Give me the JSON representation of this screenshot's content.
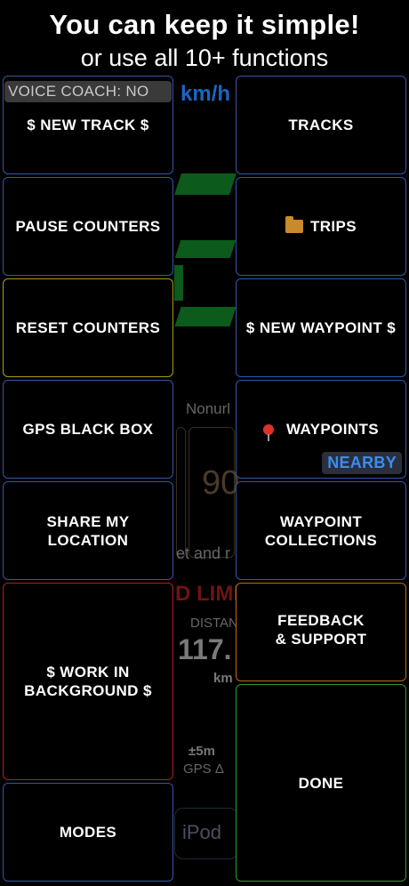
{
  "header": {
    "title": "You can keep it simple!",
    "subtitle": "or use all 10+ functions"
  },
  "background": {
    "speed_unit": "km/h",
    "unit_label_partial": "Nonurl",
    "big_digits_partial": "90",
    "text_partial": "et and r",
    "limit_partial": "D LIMI",
    "distance_label_partial": "DISTAN",
    "distance_value_partial": "117.",
    "distance_unit": "km",
    "gps_delta_value": "±5m",
    "gps_delta_label": "GPS Δ",
    "device_partial": "iPod"
  },
  "voice_coach": "VOICE COACH: NO",
  "buttons": {
    "new_track": "$ NEW TRACK $",
    "tracks": "TRACKS",
    "pause_counters": "PAUSE COUNTERS",
    "trips": "TRIPS",
    "reset_counters": "RESET COUNTERS",
    "new_waypoint": "$ NEW WAYPOINT $",
    "gps_black_box": "GPS BLACK BOX",
    "waypoints": "WAYPOINTS",
    "nearby_badge": "NEARBY",
    "share_location": "SHARE MY\nLOCATION",
    "waypoint_collections": "WAYPOINT\nCOLLECTIONS",
    "work_in_background": "$ WORK IN\nBACKGROUND $",
    "feedback_support": "FEEDBACK\n& SUPPORT",
    "modes": "MODES",
    "done": "DONE"
  },
  "colors": {
    "default_border": "#2f58a8",
    "reset_border": "#a89a20",
    "work_border": "#b81c1c",
    "feedback_border": "#c06a18",
    "done_border": "#2e9a2e",
    "nearby_text": "#3b8cf0"
  },
  "icons": {
    "trips": "folder-icon",
    "waypoints": "pin-icon"
  }
}
